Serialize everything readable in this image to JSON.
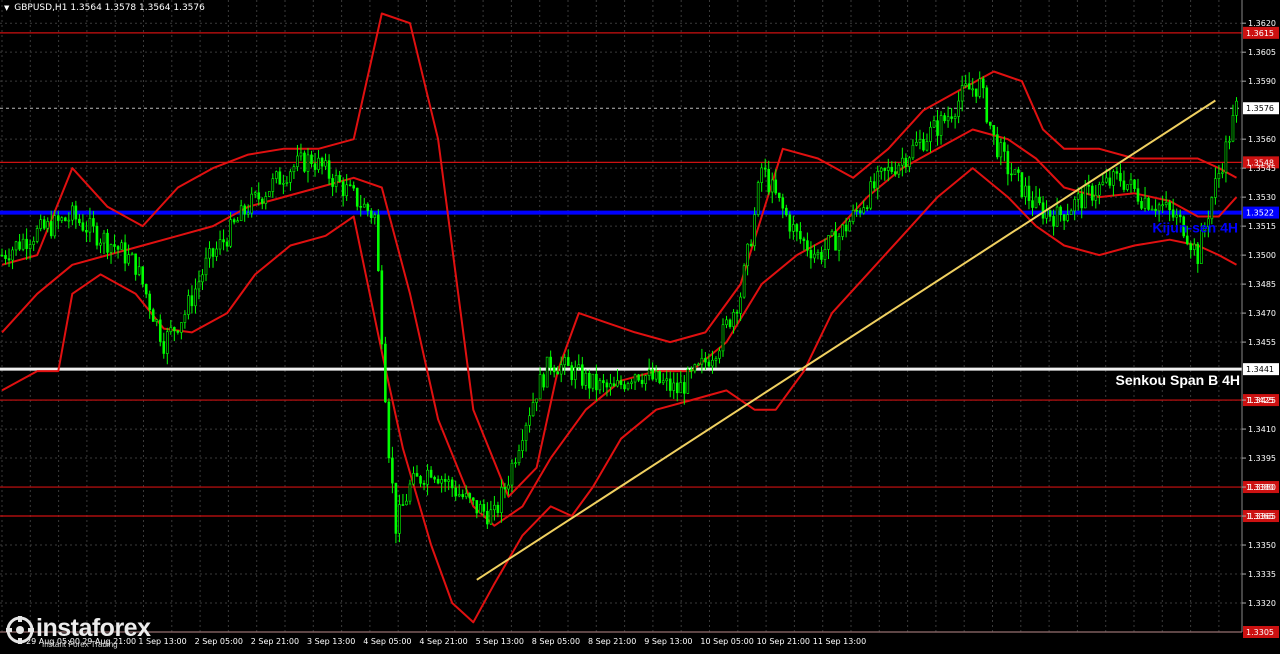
{
  "header": {
    "symbol": "GBPUSD,H1",
    "ohlc": "1.3564 1.3578 1.3564 1.3576"
  },
  "logo": {
    "name": "instaforex",
    "tagline": "Instant Forex Trading"
  },
  "colors": {
    "background": "#000000",
    "grid": "#3a3a3a",
    "candle": "#00ff00",
    "bands": "#e01010",
    "level": "#cc1111",
    "kijun": "#0000ff",
    "senkou": "#f0f0f0",
    "trendline": "#f0d060",
    "axis_text": "#ffffff"
  },
  "chart_data": {
    "type": "candlestick",
    "symbol": "GBPUSD",
    "timeframe": "H1",
    "ylim": [
      1.3305,
      1.3632
    ],
    "y_ticks": [
      "1.3620",
      "1.3605",
      "1.3590",
      "1.3560",
      "1.3545",
      "1.3530",
      "1.3515",
      "1.3500",
      "1.3485",
      "1.3470",
      "1.3455",
      "1.3425",
      "1.3410",
      "1.3395",
      "1.3380",
      "1.3365",
      "1.3350",
      "1.3335",
      "1.3320"
    ],
    "x_ticks": [
      "29 Aug 05:00",
      "29 Aug 21:00",
      "1 Sep 13:00",
      "2 Sep 05:00",
      "2 Sep 21:00",
      "3 Sep 13:00",
      "4 Sep 05:00",
      "4 Sep 21:00",
      "5 Sep 13:00",
      "8 Sep 05:00",
      "8 Sep 21:00",
      "9 Sep 13:00",
      "10 Sep 05:00",
      "10 Sep 21:00",
      "11 Sep 13:00"
    ],
    "current_price": 1.3576,
    "horizontal_levels": [
      {
        "value": 1.3615,
        "label": "1.3615",
        "kind": "resistance"
      },
      {
        "value": 1.3548,
        "label": "1.3548",
        "kind": "resistance"
      },
      {
        "value": 1.3425,
        "label": "1.3425",
        "kind": "support"
      },
      {
        "value": 1.338,
        "label": "1.3380",
        "kind": "support"
      },
      {
        "value": 1.3365,
        "label": "1.3365",
        "kind": "support"
      },
      {
        "value": 1.3305,
        "label": "1.3305",
        "kind": "support"
      }
    ],
    "kijun": {
      "value": 1.3522,
      "label": "1.3522",
      "name": "Kijun-sen 4H"
    },
    "senkou": {
      "value": 1.3441,
      "label": "1.3441",
      "name": "Senkou Span B 4H"
    },
    "trendline": {
      "start": [
        "3 Sep 10:00",
        1.3332
      ],
      "end": [
        "11 Sep 20:00",
        1.358
      ]
    },
    "price_path": [
      [
        0,
        1.35
      ],
      [
        8,
        1.351
      ],
      [
        14,
        1.3515
      ],
      [
        20,
        1.352
      ],
      [
        26,
        1.3512
      ],
      [
        32,
        1.3505
      ],
      [
        38,
        1.3495
      ],
      [
        42,
        1.3475
      ],
      [
        46,
        1.3455
      ],
      [
        52,
        1.347
      ],
      [
        58,
        1.3495
      ],
      [
        64,
        1.351
      ],
      [
        70,
        1.3525
      ],
      [
        76,
        1.3535
      ],
      [
        82,
        1.3545
      ],
      [
        88,
        1.355
      ],
      [
        94,
        1.354
      ],
      [
        100,
        1.353
      ],
      [
        106,
        1.352
      ],
      [
        110,
        1.34
      ],
      [
        112,
        1.336
      ],
      [
        116,
        1.338
      ],
      [
        122,
        1.339
      ],
      [
        128,
        1.338
      ],
      [
        134,
        1.337
      ],
      [
        140,
        1.3365
      ],
      [
        144,
        1.3385
      ],
      [
        148,
        1.341
      ],
      [
        152,
        1.343
      ],
      [
        156,
        1.3445
      ],
      [
        162,
        1.344
      ],
      [
        168,
        1.3433
      ],
      [
        174,
        1.343
      ],
      [
        180,
        1.344
      ],
      [
        186,
        1.3435
      ],
      [
        192,
        1.343
      ],
      [
        198,
        1.344
      ],
      [
        204,
        1.3455
      ],
      [
        210,
        1.348
      ],
      [
        214,
        1.352
      ],
      [
        216,
        1.3545
      ],
      [
        220,
        1.353
      ],
      [
        226,
        1.351
      ],
      [
        232,
        1.35
      ],
      [
        238,
        1.351
      ],
      [
        244,
        1.3525
      ],
      [
        250,
        1.354
      ],
      [
        256,
        1.355
      ],
      [
        262,
        1.356
      ],
      [
        268,
        1.357
      ],
      [
        274,
        1.3585
      ],
      [
        278,
        1.3588
      ],
      [
        282,
        1.356
      ],
      [
        286,
        1.3545
      ],
      [
        290,
        1.3535
      ],
      [
        294,
        1.3525
      ],
      [
        300,
        1.352
      ],
      [
        306,
        1.3528
      ],
      [
        312,
        1.3535
      ],
      [
        318,
        1.354
      ],
      [
        324,
        1.353
      ],
      [
        330,
        1.3525
      ],
      [
        336,
        1.3515
      ],
      [
        340,
        1.35
      ],
      [
        344,
        1.353
      ],
      [
        348,
        1.3555
      ],
      [
        351,
        1.3576
      ]
    ],
    "upper_band": [
      [
        0,
        1.3495
      ],
      [
        10,
        1.35
      ],
      [
        20,
        1.3545
      ],
      [
        30,
        1.3525
      ],
      [
        40,
        1.3515
      ],
      [
        50,
        1.3535
      ],
      [
        60,
        1.3545
      ],
      [
        70,
        1.3552
      ],
      [
        80,
        1.3555
      ],
      [
        90,
        1.3555
      ],
      [
        100,
        1.356
      ],
      [
        108,
        1.3625
      ],
      [
        116,
        1.362
      ],
      [
        124,
        1.356
      ],
      [
        134,
        1.342
      ],
      [
        144,
        1.3375
      ],
      [
        152,
        1.339
      ],
      [
        158,
        1.344
      ],
      [
        164,
        1.347
      ],
      [
        172,
        1.3465
      ],
      [
        180,
        1.346
      ],
      [
        190,
        1.3455
      ],
      [
        200,
        1.346
      ],
      [
        210,
        1.3485
      ],
      [
        216,
        1.352
      ],
      [
        222,
        1.3555
      ],
      [
        232,
        1.355
      ],
      [
        242,
        1.354
      ],
      [
        252,
        1.3555
      ],
      [
        262,
        1.3575
      ],
      [
        272,
        1.3585
      ],
      [
        282,
        1.3595
      ],
      [
        290,
        1.359
      ],
      [
        296,
        1.3565
      ],
      [
        302,
        1.3555
      ],
      [
        312,
        1.3555
      ],
      [
        322,
        1.355
      ],
      [
        332,
        1.355
      ],
      [
        340,
        1.355
      ],
      [
        346,
        1.3545
      ],
      [
        351,
        1.354
      ]
    ],
    "middle_band": [
      [
        0,
        1.346
      ],
      [
        10,
        1.348
      ],
      [
        20,
        1.3495
      ],
      [
        30,
        1.35
      ],
      [
        40,
        1.3505
      ],
      [
        50,
        1.351
      ],
      [
        60,
        1.3515
      ],
      [
        70,
        1.3525
      ],
      [
        80,
        1.353
      ],
      [
        90,
        1.3535
      ],
      [
        100,
        1.354
      ],
      [
        108,
        1.3535
      ],
      [
        116,
        1.348
      ],
      [
        124,
        1.3415
      ],
      [
        134,
        1.337
      ],
      [
        140,
        1.336
      ],
      [
        148,
        1.337
      ],
      [
        156,
        1.3395
      ],
      [
        166,
        1.342
      ],
      [
        176,
        1.3435
      ],
      [
        186,
        1.344
      ],
      [
        196,
        1.344
      ],
      [
        206,
        1.3455
      ],
      [
        216,
        1.3485
      ],
      [
        226,
        1.35
      ],
      [
        236,
        1.351
      ],
      [
        246,
        1.353
      ],
      [
        256,
        1.3545
      ],
      [
        266,
        1.3555
      ],
      [
        276,
        1.3565
      ],
      [
        286,
        1.356
      ],
      [
        294,
        1.355
      ],
      [
        302,
        1.3535
      ],
      [
        312,
        1.353
      ],
      [
        322,
        1.3532
      ],
      [
        332,
        1.3528
      ],
      [
        340,
        1.352
      ],
      [
        346,
        1.352
      ],
      [
        351,
        1.353
      ]
    ],
    "lower_band": [
      [
        0,
        1.343
      ],
      [
        10,
        1.344
      ],
      [
        16,
        1.344
      ],
      [
        20,
        1.348
      ],
      [
        28,
        1.349
      ],
      [
        38,
        1.348
      ],
      [
        46,
        1.3462
      ],
      [
        54,
        1.346
      ],
      [
        64,
        1.347
      ],
      [
        72,
        1.349
      ],
      [
        82,
        1.3505
      ],
      [
        92,
        1.351
      ],
      [
        100,
        1.352
      ],
      [
        108,
        1.345
      ],
      [
        114,
        1.34
      ],
      [
        122,
        1.335
      ],
      [
        128,
        1.332
      ],
      [
        134,
        1.331
      ],
      [
        140,
        1.333
      ],
      [
        148,
        1.3355
      ],
      [
        156,
        1.337
      ],
      [
        162,
        1.3365
      ],
      [
        168,
        1.338
      ],
      [
        176,
        1.3405
      ],
      [
        186,
        1.342
      ],
      [
        196,
        1.3425
      ],
      [
        206,
        1.343
      ],
      [
        214,
        1.342
      ],
      [
        220,
        1.342
      ],
      [
        228,
        1.344
      ],
      [
        236,
        1.347
      ],
      [
        246,
        1.349
      ],
      [
        256,
        1.351
      ],
      [
        266,
        1.353
      ],
      [
        276,
        1.3545
      ],
      [
        286,
        1.353
      ],
      [
        294,
        1.3515
      ],
      [
        302,
        1.3505
      ],
      [
        312,
        1.35
      ],
      [
        322,
        1.3505
      ],
      [
        332,
        1.3508
      ],
      [
        340,
        1.3505
      ],
      [
        346,
        1.35
      ],
      [
        351,
        1.3495
      ]
    ]
  }
}
